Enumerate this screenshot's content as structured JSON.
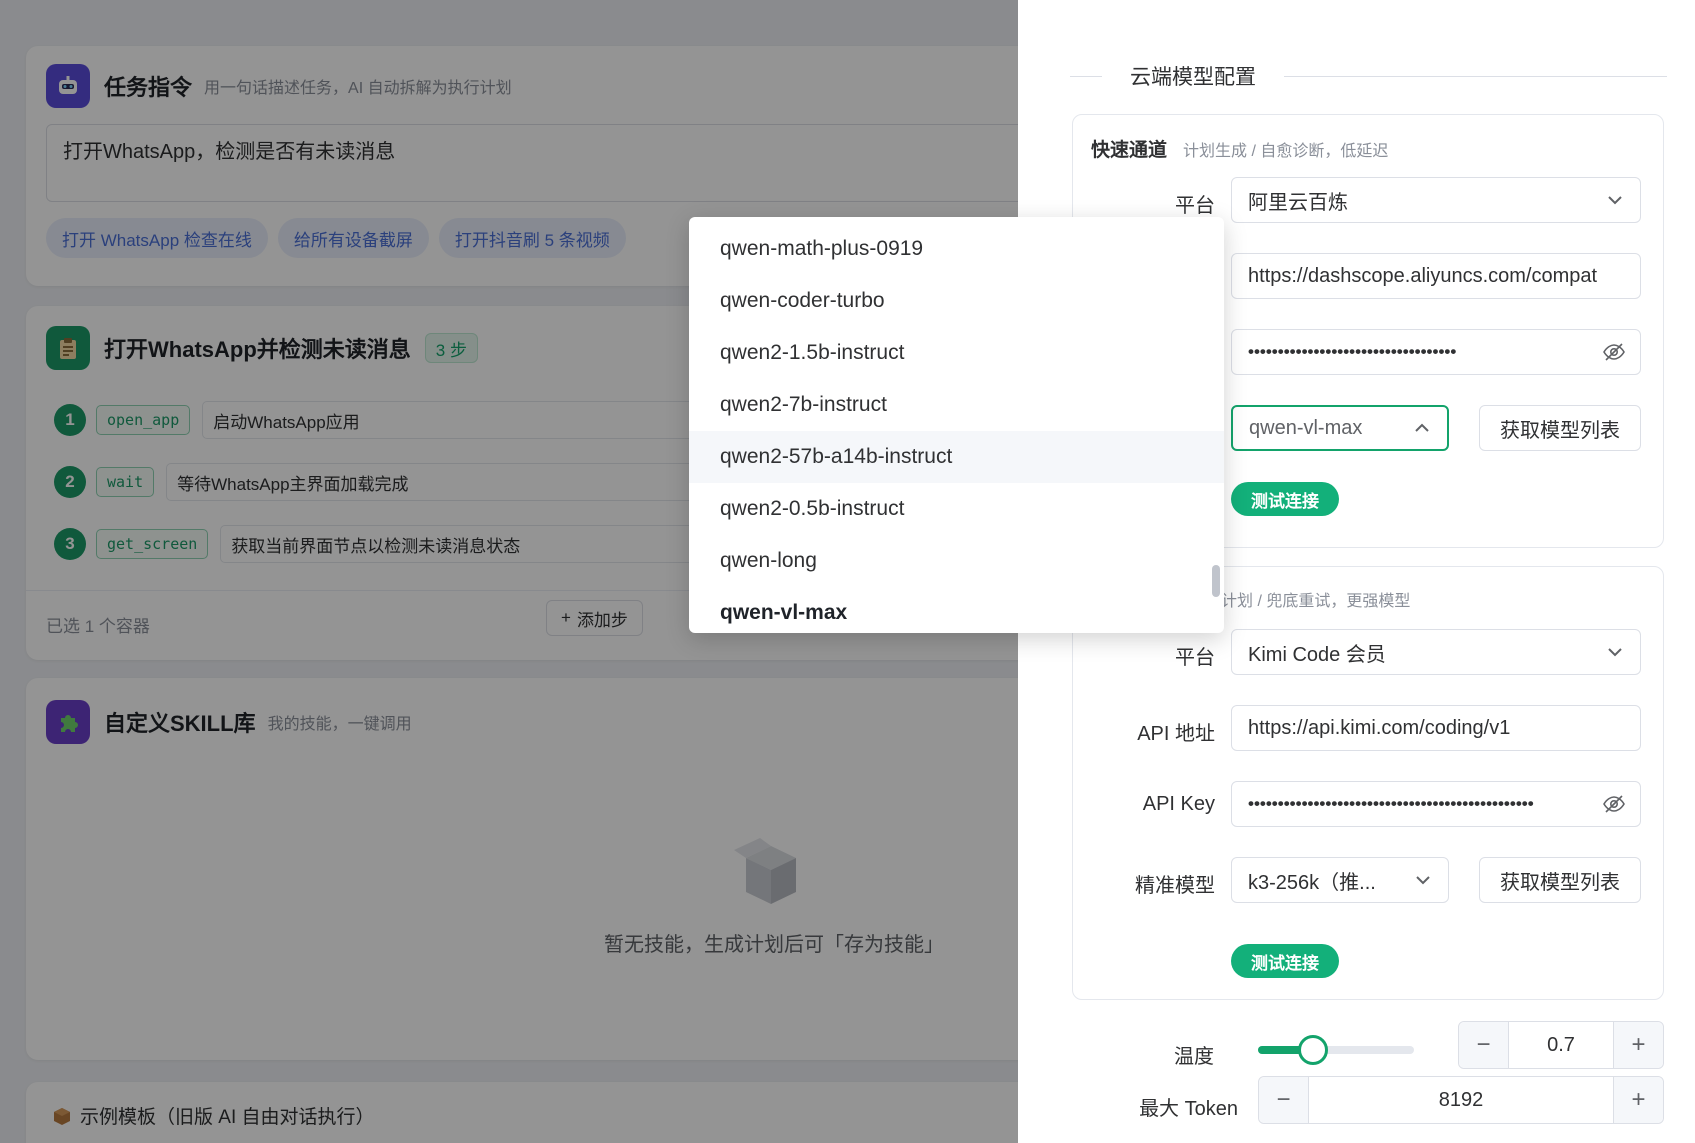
{
  "task_card": {
    "title": "任务指令",
    "subtitle": "用一句话描述任务，AI 自动拆解为执行计划",
    "input_value": "打开WhatsApp，检测是否有未读消息",
    "chips": [
      "打开 WhatsApp 检查在线",
      "给所有设备截屏",
      "打开抖音刷 5 条视频"
    ]
  },
  "plan_card": {
    "title": "打开WhatsApp并检测未读消息",
    "steps_badge": "3 步",
    "steps": [
      {
        "num": "1",
        "tag": "open_app",
        "text": "启动WhatsApp应用"
      },
      {
        "num": "2",
        "tag": "wait",
        "text": "等待WhatsApp主界面加载完成"
      },
      {
        "num": "3",
        "tag": "get_screen",
        "text": "获取当前界面节点以检测未读消息状态"
      }
    ],
    "selected": "已选 1 个容器",
    "add_step": "添加步"
  },
  "skill_card": {
    "title": "自定义SKILL库",
    "subtitle": "我的技能，一键调用",
    "empty_text": "暂无技能，生成计划后可「存为技能」"
  },
  "template_card": {
    "title": "示例模板（旧版 AI 自由对话执行）"
  },
  "drawer": {
    "section_title": "云端模型配置",
    "fast": {
      "title": "快速通道",
      "subtitle": "计划生成 / 自愈诊断，低延迟",
      "platform_label": "平台",
      "platform_value": "阿里云百炼",
      "api_url": "https://dashscope.aliyuncs.com/compat",
      "api_key_mask": "•••••••••••••••••••••••••••••••••••",
      "model_value": "qwen-vl-max",
      "fetch_label": "获取模型列表",
      "test_label": "测试连接"
    },
    "precise": {
      "subtitle": "度计划 / 兜底重试，更强模型",
      "platform_label": "平台",
      "platform_value": "Kimi Code 会员",
      "api_label": "API 地址",
      "api_url": "https://api.kimi.com/coding/v1",
      "key_label": "API Key",
      "api_key_mask": "••••••••••••••••••••••••••••••••••••••••••••••••",
      "model_label": "精准模型",
      "model_value": "k3-256k（推...",
      "fetch_label": "获取模型列表",
      "test_label": "测试连接"
    },
    "temperature": {
      "label": "温度",
      "value": "0.7",
      "fraction": 0.35
    },
    "max_token": {
      "label": "最大 Token",
      "value": "8192"
    }
  },
  "dropdown": {
    "items": [
      "qwen-math-plus-0919",
      "qwen-coder-turbo",
      "qwen2-1.5b-instruct",
      "qwen2-7b-instruct",
      "qwen2-57b-a14b-instruct",
      "qwen2-0.5b-instruct",
      "qwen-long",
      "qwen-vl-max"
    ],
    "hover_index": 4,
    "selected_index": 7
  },
  "colors": {
    "accent": "#13a36b",
    "overlay": "rgba(0,0,0,0.42)"
  }
}
